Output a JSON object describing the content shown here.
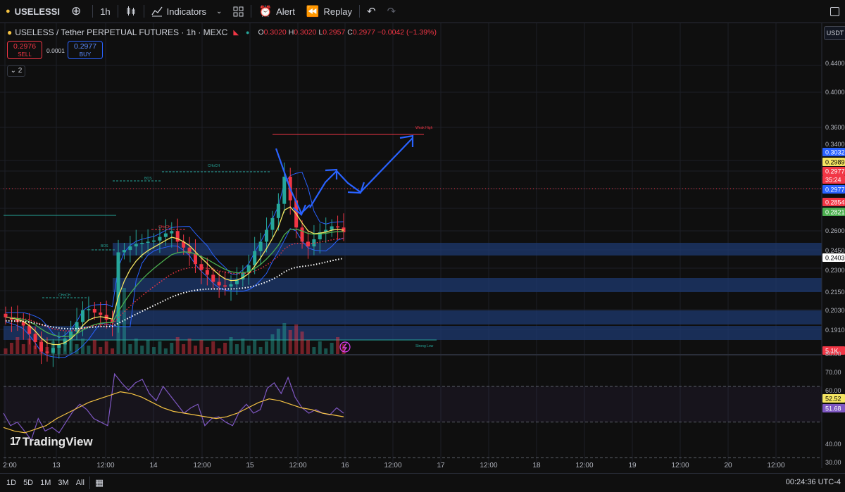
{
  "toolbar": {
    "symbol": "USELESSI",
    "add_symbol_icon": "plus-circle-icon",
    "interval": "1h",
    "chart_type_icon": "candles-icon",
    "indicators_label": "Indicators",
    "layout_icon": "grid-icon",
    "alert_label": "Alert",
    "replay_label": "Replay",
    "undo_icon": "undo-icon",
    "redo_icon": "redo-icon",
    "right_icon": "square-icon"
  },
  "legend": {
    "title": "USELESS / Tether PERPETUAL FUTURES · 1h · MEXC",
    "o_label": "O",
    "o": "0.3020",
    "h_label": "H",
    "h": "0.3020",
    "l_label": "L",
    "l": "0.2957",
    "c_label": "C",
    "c": "0.2977",
    "change": "−0.0042 (−1.39%)"
  },
  "trade": {
    "sell_price": "0.2976",
    "sell_label": "SELL",
    "spread": "0.0001",
    "buy_price": "0.2977",
    "buy_label": "BUY",
    "indicator_count": "2"
  },
  "currency": "USDT",
  "price_axis": {
    "ticks": [
      "0.4400",
      "0.4000",
      "0.3600",
      "0.3400",
      "0.2600",
      "0.2450",
      "0.2300",
      "0.2150",
      "0.2030",
      "0.1910"
    ],
    "tags": [
      {
        "text": "0.3032",
        "color": "#2962ff"
      },
      {
        "text": "0.2989",
        "color": "#f5e663"
      },
      {
        "text": "0.2977",
        "color": "#f23645"
      },
      {
        "text": "35:24",
        "color": "#f23645"
      },
      {
        "text": "0.2977",
        "color": "#2962ff"
      },
      {
        "text": "0.2854",
        "color": "#f23645"
      },
      {
        "text": "0.2821",
        "color": "#4caf50"
      },
      {
        "text": "0.2403",
        "color": "#ffffff"
      },
      {
        "text": "5.1K",
        "color": "#f23645"
      }
    ]
  },
  "rsi_axis": {
    "ticks": [
      "80.00",
      "70.00",
      "60.00",
      "50.00",
      "40.00",
      "30.00"
    ],
    "tags": [
      {
        "text": "52.52",
        "color": "#f5e663"
      },
      {
        "text": "51.68",
        "color": "#7e57c2"
      }
    ]
  },
  "annotations": {
    "weak_high": "Weak High",
    "strong_low": "Strong Low",
    "choch_1": "CHoCH",
    "choch_2": "CHoCH",
    "choch_3": "CHoCH",
    "bos_1": "BOS",
    "bos_2": "BOS"
  },
  "time_axis": {
    "ticks": [
      "2:00",
      "13",
      "12:00",
      "14",
      "12:00",
      "15",
      "12:00",
      "16",
      "12:00",
      "17",
      "12:00",
      "18",
      "12:00",
      "19",
      "12:00",
      "20",
      "12:00"
    ]
  },
  "bottom": {
    "ranges": [
      "1D",
      "5D",
      "1M",
      "3M",
      "All"
    ],
    "calendar_icon": "calendar-icon",
    "clock": "00:24:36 UTC-4"
  },
  "branding": "TradingView",
  "colors": {
    "up": "#26a69a",
    "down": "#f23645",
    "ema_fast": "#f5e663",
    "ema_mid": "#4caf50",
    "band": "#2962ff",
    "zone": "#1e3a70",
    "rsi": "#7e57c2",
    "rsi_ma": "#f5c343"
  },
  "chart_data": {
    "type": "candlestick",
    "x_labels": [
      "2:00",
      "13",
      "12:00",
      "14",
      "12:00",
      "15",
      "12:00",
      "16"
    ],
    "ohlc_last": {
      "open": 0.302,
      "high": 0.302,
      "low": 0.2957,
      "close": 0.2977
    },
    "close_path": [
      0.226,
      0.224,
      0.222,
      0.219,
      0.212,
      0.205,
      0.197,
      0.196,
      0.2,
      0.203,
      0.208,
      0.214,
      0.222,
      0.232,
      0.233,
      0.23,
      0.228,
      0.224,
      0.222,
      0.281,
      0.283,
      0.286,
      0.288,
      0.289,
      0.29,
      0.291,
      0.294,
      0.297,
      0.299,
      0.29,
      0.285,
      0.28,
      0.271,
      0.266,
      0.262,
      0.256,
      0.253,
      0.252,
      0.254,
      0.258,
      0.264,
      0.27,
      0.282,
      0.29,
      0.3,
      0.31,
      0.322,
      0.345,
      0.325,
      0.302,
      0.29,
      0.286,
      0.292,
      0.298,
      0.3,
      0.303,
      0.302,
      0.298
    ],
    "rsi_path": [
      55,
      48,
      50,
      45,
      40,
      52,
      45,
      47,
      44,
      50,
      56,
      60,
      57,
      52,
      50,
      48,
      77,
      72,
      68,
      72,
      74,
      66,
      62,
      70,
      65,
      60,
      55,
      58,
      60,
      48,
      52,
      53,
      50,
      48,
      56,
      60,
      55,
      57,
      69,
      72,
      66,
      75,
      64,
      58,
      55,
      57,
      55,
      54,
      58,
      55
    ],
    "rsi_ma_path": [
      47,
      45,
      44,
      46,
      48,
      52,
      55,
      58,
      61,
      63,
      65,
      67,
      66,
      64,
      61,
      58,
      56,
      55,
      54,
      53,
      52,
      53,
      55,
      58,
      61,
      63,
      62,
      60,
      58,
      57,
      55,
      54,
      53
    ],
    "ylim": [
      0.18,
      0.46
    ],
    "rsi_ylim": [
      30,
      80
    ]
  }
}
